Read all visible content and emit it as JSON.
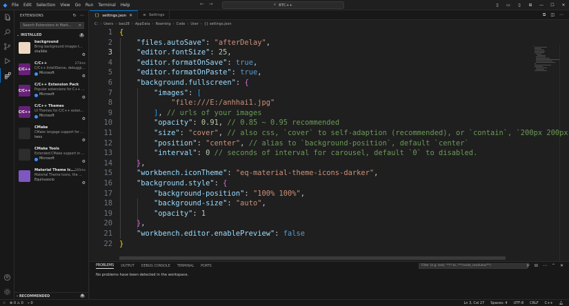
{
  "menu": [
    "File",
    "Edit",
    "Selection",
    "View",
    "Go",
    "Run",
    "Terminal",
    "Help"
  ],
  "search_box": "BTC++",
  "sidebar": {
    "title": "EXTENSIONS",
    "search_placeholder": "Search Extensions in Mark...",
    "installed_label": "INSTALLED",
    "installed_count": "7",
    "recommended_label": "RECOMMENDED",
    "recommended_count": "0",
    "extensions": [
      {
        "name": "background",
        "meta": "",
        "desc": "Bring background images t...",
        "publisher": "shalldie",
        "icon_color": "#f0d9c2",
        "icon_text": "",
        "verified": false
      },
      {
        "name": "C/C++",
        "meta": "273ms",
        "desc": "C/C++ IntelliSense, debuggi...",
        "publisher": "Microsoft",
        "icon_color": "#68217a",
        "icon_text": "C/C++",
        "verified": true
      },
      {
        "name": "C/C++ Extension Pack",
        "meta": "",
        "desc": "Popular extensions for C++ ...",
        "publisher": "Microsoft",
        "icon_color": "#68217a",
        "icon_text": "C/C++",
        "verified": true
      },
      {
        "name": "C/C++ Themes",
        "meta": "",
        "desc": "UI Themes for C/C++ exten...",
        "publisher": "Microsoft",
        "icon_color": "#68217a",
        "icon_text": "C/C++",
        "verified": true
      },
      {
        "name": "CMake",
        "meta": "",
        "desc": "CMake langage support for ...",
        "publisher": "twxs",
        "icon_color": "#2d2d2d",
        "icon_text": "",
        "verified": false
      },
      {
        "name": "CMake Tools",
        "meta": "",
        "desc": "Extended CMake support in ...",
        "publisher": "Microsoft",
        "icon_color": "#2d2d2d",
        "icon_text": "",
        "verified": true
      },
      {
        "name": "Material Theme Ic...",
        "meta": "205ms",
        "desc": "Material Theme Icons, the ...",
        "publisher": "Equinusocio",
        "icon_color": "#7e57c2",
        "icon_text": "",
        "verified": false
      }
    ]
  },
  "tabs": [
    {
      "label": "settings.json",
      "active": true
    },
    {
      "label": "Settings",
      "active": false
    }
  ],
  "breadcrumb": [
    "C:",
    "Users",
    "bao28",
    "AppData",
    "Roaming",
    "Code",
    "User",
    "{} settings.json"
  ],
  "code_lines": [
    {
      "n": "1",
      "tokens": [
        [
          "br1",
          "{"
        ]
      ]
    },
    {
      "n": "2",
      "tokens": [
        [
          "p",
          "    "
        ],
        [
          "k",
          "\"files.autoSave\""
        ],
        [
          "p",
          ": "
        ],
        [
          "s",
          "\"afterDelay\""
        ],
        [
          "p",
          ","
        ]
      ]
    },
    {
      "n": "3",
      "tokens": [
        [
          "p",
          "    "
        ],
        [
          "k",
          "\"editor.fontSize\""
        ],
        [
          "p",
          ": "
        ],
        [
          "n",
          "25"
        ],
        [
          "p",
          ","
        ]
      ]
    },
    {
      "n": "4",
      "tokens": [
        [
          "p",
          "    "
        ],
        [
          "k",
          "\"editor.formatOnSave\""
        ],
        [
          "p",
          ": "
        ],
        [
          "b",
          "true"
        ],
        [
          "p",
          ","
        ]
      ]
    },
    {
      "n": "5",
      "tokens": [
        [
          "p",
          "    "
        ],
        [
          "k",
          "\"editor.formatOnPaste\""
        ],
        [
          "p",
          ": "
        ],
        [
          "b",
          "true"
        ],
        [
          "p",
          ","
        ]
      ]
    },
    {
      "n": "6",
      "tokens": [
        [
          "p",
          "    "
        ],
        [
          "k",
          "\"background.fullscreen\""
        ],
        [
          "p",
          ": "
        ],
        [
          "br2",
          "{"
        ]
      ]
    },
    {
      "n": "7",
      "tokens": [
        [
          "p",
          "        "
        ],
        [
          "k",
          "\"images\""
        ],
        [
          "p",
          ": "
        ],
        [
          "br3",
          "["
        ]
      ]
    },
    {
      "n": "8",
      "tokens": [
        [
          "p",
          "            "
        ],
        [
          "s",
          "\"file:///E:/anhhai1.jpg\""
        ]
      ]
    },
    {
      "n": "9",
      "tokens": [
        [
          "p",
          "        "
        ],
        [
          "br3",
          "]"
        ],
        [
          "p",
          ", "
        ],
        [
          "c",
          "// urls of your images"
        ]
      ]
    },
    {
      "n": "10",
      "tokens": [
        [
          "p",
          "        "
        ],
        [
          "k",
          "\"opacity\""
        ],
        [
          "p",
          ": "
        ],
        [
          "n",
          "0.91"
        ],
        [
          "p",
          ", "
        ],
        [
          "c",
          "// 0.85 ~ 0.95 recommended"
        ]
      ]
    },
    {
      "n": "11",
      "tokens": [
        [
          "p",
          "        "
        ],
        [
          "k",
          "\"size\""
        ],
        [
          "p",
          ": "
        ],
        [
          "s",
          "\"cover\""
        ],
        [
          "p",
          ", "
        ],
        [
          "c",
          "// also css, `cover` to self-adaption (recommended), or `contain`, `200px 200px`"
        ]
      ]
    },
    {
      "n": "12",
      "tokens": [
        [
          "p",
          "        "
        ],
        [
          "k",
          "\"position\""
        ],
        [
          "p",
          ": "
        ],
        [
          "s",
          "\"center\""
        ],
        [
          "p",
          ", "
        ],
        [
          "c",
          "// alias to `background-position`, default `center`"
        ]
      ]
    },
    {
      "n": "13",
      "tokens": [
        [
          "p",
          "        "
        ],
        [
          "k",
          "\"interval\""
        ],
        [
          "p",
          ": "
        ],
        [
          "n",
          "0"
        ],
        [
          "p",
          " "
        ],
        [
          "c",
          "// seconds of interval for carousel, default `0` to disabled."
        ]
      ]
    },
    {
      "n": "14",
      "tokens": [
        [
          "p",
          "    "
        ],
        [
          "br2",
          "}"
        ],
        [
          "p",
          ","
        ]
      ]
    },
    {
      "n": "15",
      "tokens": [
        [
          "p",
          "    "
        ],
        [
          "k",
          "\"workbench.iconTheme\""
        ],
        [
          "p",
          ": "
        ],
        [
          "s",
          "\"eq-material-theme-icons-darker\""
        ],
        [
          "p",
          ","
        ]
      ]
    },
    {
      "n": "16",
      "tokens": [
        [
          "p",
          "    "
        ],
        [
          "k",
          "\"background.style\""
        ],
        [
          "p",
          ": "
        ],
        [
          "br2",
          "{"
        ]
      ]
    },
    {
      "n": "17",
      "tokens": [
        [
          "p",
          "        "
        ],
        [
          "k",
          "\"background-position\""
        ],
        [
          "p",
          ": "
        ],
        [
          "s",
          "\"100% 100%\""
        ],
        [
          "p",
          ","
        ]
      ]
    },
    {
      "n": "18",
      "tokens": [
        [
          "p",
          "        "
        ],
        [
          "k",
          "\"background-size\""
        ],
        [
          "p",
          ": "
        ],
        [
          "s",
          "\"auto\""
        ],
        [
          "p",
          ","
        ]
      ]
    },
    {
      "n": "19",
      "tokens": [
        [
          "p",
          "        "
        ],
        [
          "k",
          "\"opacity\""
        ],
        [
          "p",
          ": "
        ],
        [
          "n",
          "1"
        ]
      ]
    },
    {
      "n": "20",
      "tokens": [
        [
          "p",
          "    "
        ],
        [
          "br2",
          "}"
        ],
        [
          "p",
          ","
        ]
      ]
    },
    {
      "n": "21",
      "tokens": [
        [
          "p",
          "    "
        ],
        [
          "k",
          "\"workbench.editor.enablePreview\""
        ],
        [
          "p",
          ": "
        ],
        [
          "b",
          "false"
        ]
      ]
    },
    {
      "n": "22",
      "tokens": [
        [
          "br1",
          "}"
        ]
      ]
    }
  ],
  "current_line": "3",
  "panel": {
    "tabs": [
      "PROBLEMS",
      "OUTPUT",
      "DEBUG CONSOLE",
      "TERMINAL",
      "PORTS"
    ],
    "filter_placeholder": "Filter (e.g. text, **/*.ts, !**/node_modules/**)",
    "message": "No problems have been detected in the workspace."
  },
  "status": {
    "errors": "0",
    "warnings": "0",
    "ports": "0",
    "position": "Ln 3, Col 27",
    "spaces": "Spaces: 4",
    "encoding": "UTF-8",
    "eol": "CRLF",
    "language": "C++"
  },
  "colors": {
    "accent": "#0078d4",
    "comment": "#6a9955",
    "string": "#ce9178",
    "key": "#9cdcfe"
  },
  "icons": [
    "vscode-logo-icon",
    "explorer-icon",
    "search-icon",
    "source-control-icon",
    "run-debug-icon",
    "extensions-icon",
    "account-icon",
    "settings-gear-icon"
  ]
}
